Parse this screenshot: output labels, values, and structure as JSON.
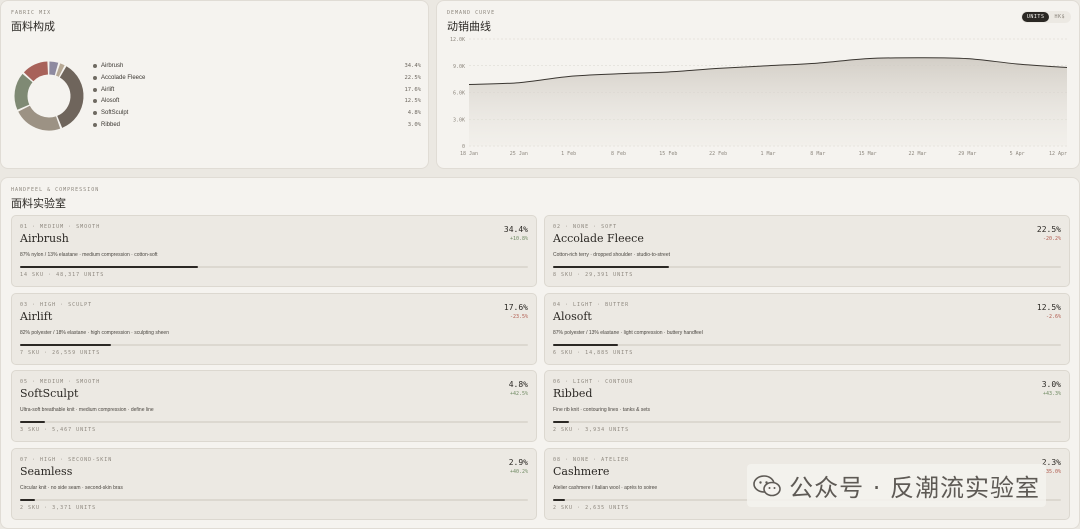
{
  "fabric_mix": {
    "eyebrow": "FABRIC MIX",
    "title": "面料构成",
    "items": [
      {
        "name": "Airbrush",
        "pct": "34.4%",
        "value": 34.4,
        "color": "#6f655c"
      },
      {
        "name": "Accolade Fleece",
        "pct": "22.5%",
        "value": 22.5,
        "color": "#9c9284"
      },
      {
        "name": "Airlift",
        "pct": "17.6%",
        "value": 17.6,
        "color": "#7f8a74"
      },
      {
        "name": "Alosoft",
        "pct": "12.5%",
        "value": 12.5,
        "color": "#a8625a"
      },
      {
        "name": "SoftSculpt",
        "pct": "4.8%",
        "value": 4.8,
        "color": "#8e8aa0"
      },
      {
        "name": "Ribbed",
        "pct": "3.0%",
        "value": 3.0,
        "color": "#b7a995"
      }
    ]
  },
  "demand": {
    "eyebrow": "DEMAND CURVE",
    "title": "动销曲线",
    "toggle": {
      "on": "UNITS",
      "off": "HK$"
    }
  },
  "chart_data": {
    "type": "area",
    "x": [
      "18 Jan",
      "25 Jan",
      "1 Feb",
      "8 Feb",
      "15 Feb",
      "22 Feb",
      "1 Mar",
      "8 Mar",
      "15 Mar",
      "22 Mar",
      "29 Mar",
      "5 Apr",
      "12 Apr"
    ],
    "values": [
      6900,
      7100,
      7800,
      8100,
      8300,
      8700,
      9000,
      9300,
      9800,
      9900,
      9800,
      9200,
      8800
    ],
    "yticks": [
      "12.0K",
      "9.0K",
      "6.0K",
      "3.0K",
      "0"
    ],
    "ylim": [
      0,
      12000
    ],
    "grid": true
  },
  "lab": {
    "eyebrow": "HANDFEEL & COMPRESSION",
    "title": "面料实验室",
    "cards": [
      {
        "meta": "01 · MEDIUM · SMOOTH",
        "name": "Airbrush",
        "desc": "87% nylon / 13% elastane · medium compression · cotton-soft",
        "foot": "14 SKU · 48,317 UNITS",
        "share": "34.4%",
        "delta": "+10.8%",
        "delta_dir": "up",
        "fill": 0.344
      },
      {
        "meta": "02 · NONE · SOFT",
        "name": "Accolade Fleece",
        "desc": "Cotton-rich terry · dropped shoulder · studio-to-street",
        "foot": "8 SKU · 29,391 UNITS",
        "share": "22.5%",
        "delta": "-20.2%",
        "delta_dir": "down",
        "fill": 0.225
      },
      {
        "meta": "03 · HIGH · SCULPT",
        "name": "Airlift",
        "desc": "82% polyester / 18% elastane · high compression · sculpting sheen",
        "foot": "7 SKU · 26,559 UNITS",
        "share": "17.6%",
        "delta": "-23.5%",
        "delta_dir": "down",
        "fill": 0.176
      },
      {
        "meta": "04 · LIGHT · BUTTER",
        "name": "Alosoft",
        "desc": "87% polyester / 13% elastane · light compression · buttery handfeel",
        "foot": "6 SKU · 14,885 UNITS",
        "share": "12.5%",
        "delta": "-2.6%",
        "delta_dir": "down",
        "fill": 0.125
      },
      {
        "meta": "05 · MEDIUM · SMOOTH",
        "name": "SoftSculpt",
        "desc": "Ultra-soft breathable knit · medium compression · define line",
        "foot": "3 SKU · 5,467 UNITS",
        "share": "4.8%",
        "delta": "+42.5%",
        "delta_dir": "up",
        "fill": 0.048
      },
      {
        "meta": "06 · LIGHT · CONTOUR",
        "name": "Ribbed",
        "desc": "Fine rib knit · contouring lines · tanks & sets",
        "foot": "2 SKU · 3,934 UNITS",
        "share": "3.0%",
        "delta": "+43.3%",
        "delta_dir": "up",
        "fill": 0.03
      },
      {
        "meta": "07 · HIGH · SECOND-SKIN",
        "name": "Seamless",
        "desc": "Circular knit · no side seam · second-skin bras",
        "foot": "2 SKU · 3,371 UNITS",
        "share": "2.9%",
        "delta": "+40.2%",
        "delta_dir": "up",
        "fill": 0.029
      },
      {
        "meta": "08 · NONE · ATELIER",
        "name": "Cashmere",
        "desc": "Atelier cashmere / Italian wool · après to soiree",
        "foot": "2 SKU · 2,635 UNITS",
        "share": "2.3%",
        "delta": "-35.0%",
        "delta_dir": "down",
        "fill": 0.023
      }
    ]
  },
  "watermark": {
    "text": "公众号 · 反潮流实验室"
  }
}
